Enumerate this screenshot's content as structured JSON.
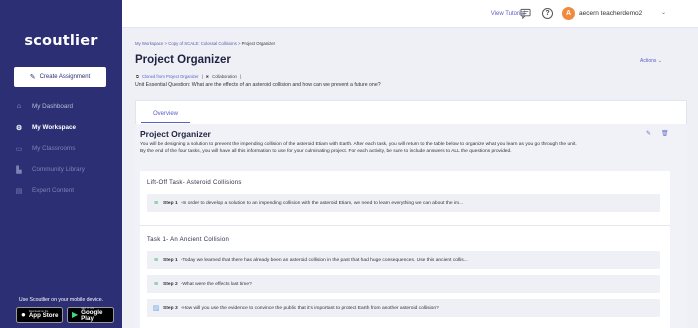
{
  "sidebar": {
    "logo_text": "scoutlier",
    "create_label": "Create Assignment",
    "items": [
      {
        "label": "My Dashboard",
        "icon": "home-icon"
      },
      {
        "label": "My Workspace",
        "icon": "workspace-icon"
      },
      {
        "label": "My Classrooms",
        "icon": "classroom-icon"
      },
      {
        "label": "Community Library",
        "icon": "library-icon"
      },
      {
        "label": "Expert Content",
        "icon": "expert-icon"
      }
    ],
    "mobile_text": "Use Scoutlier on your mobile device.",
    "app_store_small": "Download on the",
    "app_store_big": "App Store",
    "google_play_small": "GET IT ON",
    "google_play_big": "Google Play"
  },
  "topbar": {
    "tutorial_label": "View Tutorial",
    "avatar_letter": "A",
    "username": "aecern teacherdemo2",
    "accent": "#5a5fc4",
    "avatar_color": "#f08a3e"
  },
  "breadcrumb": {
    "path": "My Workspace > Copy of SCALE: Colossal Collisions > ",
    "current": "Project Organizer"
  },
  "page": {
    "title": "Project Organizer",
    "actions_label": "Actions",
    "cloned_text": "Cloned from Project Organizer",
    "collab_text": "Collaboration",
    "essential_question": "Unit Essential Question: What are the effects of an asteroid collision and how can we prevent a future one?",
    "tab_label": "Overview"
  },
  "organizer": {
    "title": "Project Organizer",
    "description": "You will be designing a solution to prevent the impending collision of the asteroid Etiam with Earth. After each task, you will return to the table below to organize what you learn as you go through the unit. By the end of the four tasks, you will have all this information to use for your culminating project. For each activity, be sure to include answers to ALL the questions provided.",
    "sections": [
      {
        "title": "Lift-Off Task- Asteroid Collisions",
        "steps": [
          {
            "label": "Step 1",
            "text": "-In order to develop a solution to an impending collision with the asteroid Etiam, we need to learn everything we can about the im...",
            "icon": "list-icon"
          }
        ]
      },
      {
        "title": "Task 1- An Ancient Collision",
        "steps": [
          {
            "label": "Step 1",
            "text": "-Today we learned that there has already been an asteroid collision in the past that had huge consequences. Use this ancient collis...",
            "icon": "list-icon"
          },
          {
            "label": "Step 2",
            "text": "-What were the effects last time?",
            "icon": "list-icon"
          },
          {
            "label": "Step 3",
            "text": "-How will you use the evidence to convince the public that it's important to protect Earth from another asteroid collision?",
            "icon": "image-icon"
          }
        ]
      }
    ]
  }
}
